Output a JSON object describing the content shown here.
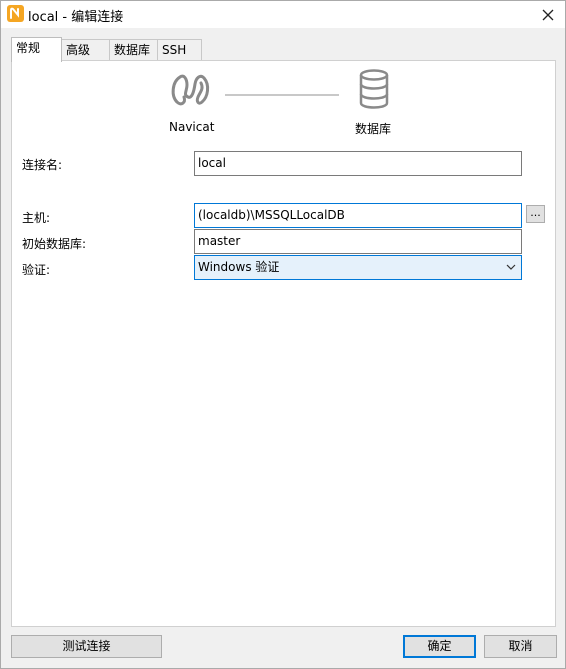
{
  "window": {
    "title": "local - 编辑连接",
    "app_icon": "navicat-app-icon",
    "close_icon": "close-icon"
  },
  "tabs": [
    {
      "label": "常规",
      "active": true
    },
    {
      "label": "高级",
      "active": false
    },
    {
      "label": "数据库",
      "active": false
    },
    {
      "label": "SSH",
      "active": false
    }
  ],
  "diagram": {
    "client_label": "Navicat",
    "server_label": "数据库"
  },
  "form": {
    "connection_name_label": "连接名:",
    "connection_name_value": "local",
    "host_label": "主机:",
    "host_value": "(localdb)\\MSSQLLocalDB",
    "host_browse_label": "...",
    "initial_db_label": "初始数据库:",
    "initial_db_value": "master",
    "auth_label": "验证:",
    "auth_value": "Windows 验证"
  },
  "buttons": {
    "test": "测试连接",
    "ok": "确定",
    "cancel": "取消"
  },
  "colors": {
    "accent": "#0078d7",
    "app_icon": "#f5a623"
  }
}
